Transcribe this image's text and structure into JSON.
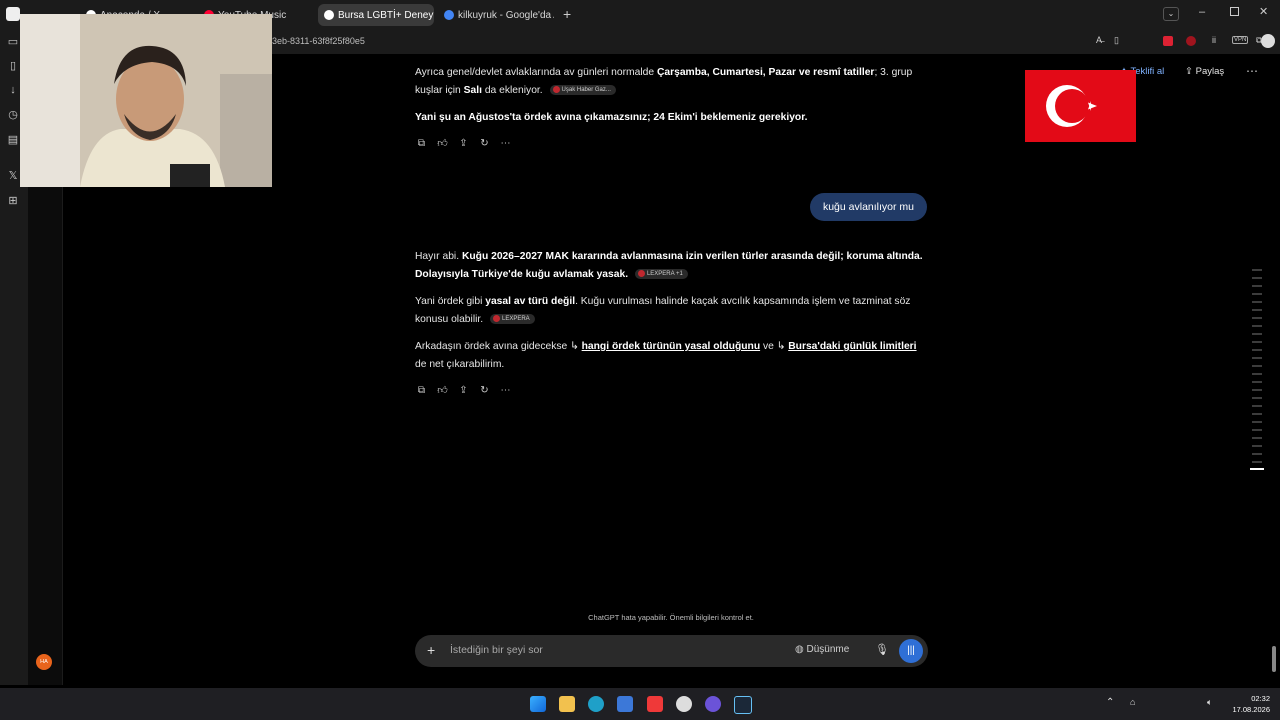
{
  "tabs": [
    {
      "label": "Anaconda / X",
      "color": "#ffffff"
    },
    {
      "label": "YouTube Music",
      "color": "#ff0033"
    },
    {
      "label": "Bursa LGBTİ+ Deneyimi Öz",
      "color": "#ffffff"
    },
    {
      "label": "kilkuyruk - Google'da Ara",
      "color": "#4285f4"
    }
  ],
  "url_fragment": "3eb-8311-63f8f25f80e5",
  "header": {
    "share_label": "Paylaş",
    "offer_label": "Teklifi al"
  },
  "messages": {
    "m1_p1_a": "Ayrıca genel/devlet avlaklarında av günleri normalde ",
    "m1_p1_b": "Çarşamba, Cumartesi, Pazar ve resmî tatiller",
    "m1_p1_c": "; 3. grup kuşlar için ",
    "m1_p1_d": "Salı",
    "m1_p1_e": " da ekleniyor.",
    "m1_chip": "Uşak Haber Gaz...",
    "m1_p2": "Yani şu an Ağustos'ta ördek avına çıkamazsınız; 24 Ekim'i beklemeniz gerekiyor.",
    "user_question": "kuğu avlanılıyor mu",
    "m2_p1_a": "Hayır abi. ",
    "m2_p1_b": "Kuğu 2026–2027 MAK kararında avlanmasına izin verilen türler arasında değil; koruma altında. Dolayısıyla Türkiye'de kuğu avlamak yasak.",
    "m2_chip1": "LEXPERA +1",
    "m2_p2_a": "Yani ördek gibi ",
    "m2_p2_b": "yasal av türü değil",
    "m2_p2_c": ". Kuğu vurulması halinde kaçak avcılık kapsamında işlem ve tazminat söz konusu olabilir.",
    "m2_chip2": "LEXPERA",
    "m2_p3_a": "Arkadaşın ördek avına gidecekse ",
    "m2_p3_link1": "hangi ördek türünün yasal olduğunu",
    "m2_p3_mid": " ve ",
    "m2_p3_link2": "Bursa'daki günlük limitleri",
    "m2_p3_c": " de net çıkarabilirim."
  },
  "disclaimer": "ChatGPT hata yapabilir. Önemli bilgileri kontrol et.",
  "composer": {
    "placeholder": "İstediğin bir şeyi sor",
    "thinking_label": "Düşünme"
  },
  "avatar_initials": "HA",
  "clock": {
    "time": "02:32",
    "date": "17.08.2026"
  },
  "icons": [
    "copy-icon",
    "thumbs-icon",
    "share-icon",
    "regenerate-icon",
    "more-icon",
    "plus-icon",
    "mic-icon",
    "voice-icon"
  ]
}
